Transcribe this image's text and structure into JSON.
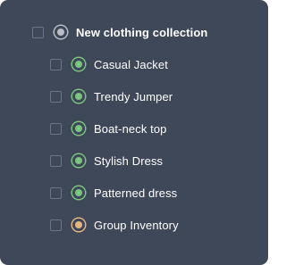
{
  "tree": {
    "parent": {
      "label": "New clothing collection",
      "status_color": "#b9bdc7"
    },
    "items": [
      {
        "label": "Casual Jacket",
        "status_color": "#7cc47f"
      },
      {
        "label": "Trendy Jumper",
        "status_color": "#7cc47f"
      },
      {
        "label": "Boat-neck top",
        "status_color": "#7cc47f"
      },
      {
        "label": "Stylish Dress",
        "status_color": "#7cc47f"
      },
      {
        "label": "Patterned dress",
        "status_color": "#7cc47f"
      },
      {
        "label": "Group Inventory",
        "status_color": "#e3b77e"
      }
    ]
  }
}
